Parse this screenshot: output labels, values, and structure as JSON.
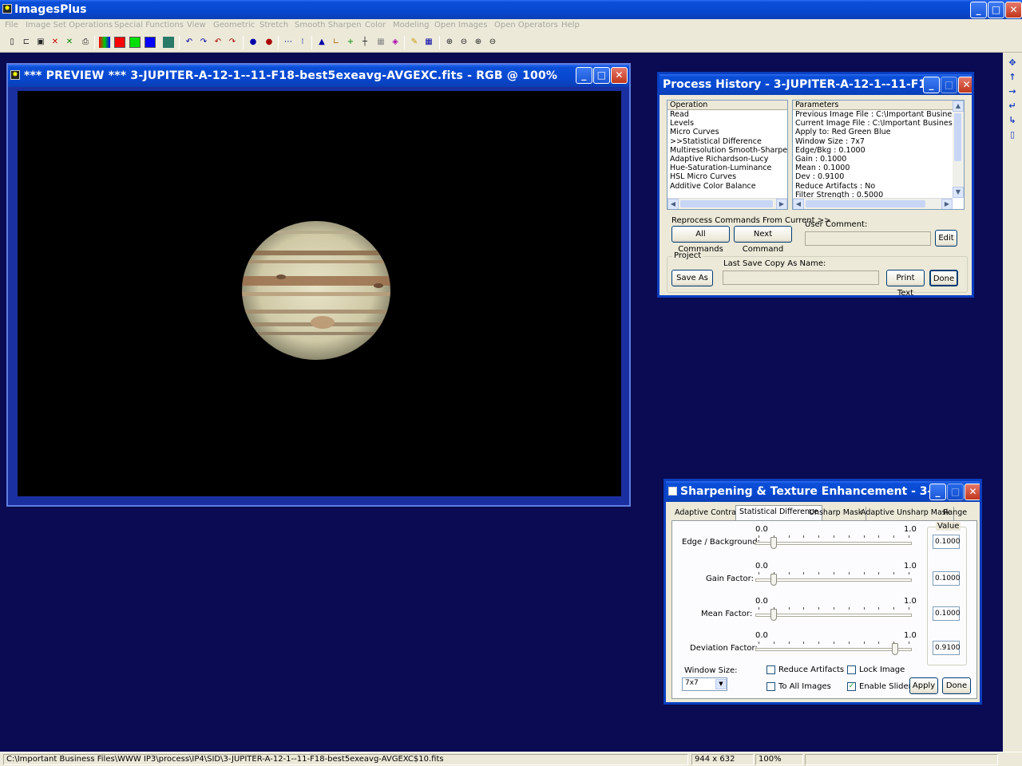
{
  "app": {
    "title": "ImagesPlus"
  },
  "menu": [
    "File",
    "Image Set Operations",
    "Special Functions",
    "View",
    "Geometric",
    "Stretch",
    "Smooth Sharpen",
    "Color",
    "Modeling",
    "Open Images",
    "Open Operators",
    "Help"
  ],
  "preview": {
    "title": "*** PREVIEW *** 3-JUPITER-A-12-1--11-F18-best5exeavg-AVGEXC.fits - RGB @  100%"
  },
  "history": {
    "title": "Process History - 3-JUPITER-A-12-1--11-F1...",
    "operation_header": "Operation",
    "operations": [
      "Read",
      "Levels",
      "Micro Curves",
      ">>Statistical Difference",
      "Multiresolution Smooth-Sharpen",
      "Adaptive Richardson-Lucy",
      "Hue-Saturation-Luminance",
      "HSL Micro Curves",
      "Additive Color Balance"
    ],
    "parameters_header": "Parameters",
    "parameters": [
      "Previous Image File : C:\\Important Business Files\\W",
      "Current Image File : C:\\Important Business Files\\W",
      "Apply to:  Red Green Blue",
      "Window Size : 7x7",
      "Edge/Bkg : 0.1000",
      "Gain : 0.1000",
      "Mean : 0.1000",
      "Dev : 0.9100",
      "Reduce Artifacts : No",
      "Filter Strength : 0.5000"
    ],
    "reprocess_label": "Reprocess Commands From Current >>",
    "all_commands": "All Commands",
    "next_command": "Next Command",
    "user_comment_label": "User Comment:",
    "user_comment_value": "",
    "edit": "Edit",
    "project_label": "Project",
    "last_save_label": "Last Save Copy As Name:",
    "last_save_value": "",
    "save_as": "Save As",
    "print_text": "Print Text",
    "done": "Done"
  },
  "sharpen": {
    "title": "Sharpening & Texture Enhancement - 3-...",
    "tabs": [
      "Adaptive Contrast",
      "Statistical Difference",
      "Unsharp Mask",
      "Adaptive Unsharp Mask",
      "Range"
    ],
    "active_tab": "Statistical Difference",
    "value_group": "Value",
    "min_label": "0.0",
    "max_label": "1.0",
    "sliders": [
      {
        "label": "Edge / Background:",
        "value": "0.1000",
        "level": 0.1
      },
      {
        "label": "Gain Factor:",
        "value": "0.1000",
        "level": 0.1
      },
      {
        "label": "Mean Factor:",
        "value": "0.1000",
        "level": 0.1
      },
      {
        "label": "Deviation Factor:",
        "value": "0.9100",
        "level": 0.91
      }
    ],
    "window_size_label": "Window Size:",
    "window_size_value": "7x7",
    "reduce_artifacts": {
      "label": "Reduce Artifacts",
      "checked": false
    },
    "lock_image": {
      "label": "Lock Image",
      "checked": false
    },
    "to_all_images": {
      "label": "To All Images",
      "checked": false
    },
    "enable_sliders": {
      "label": "Enable Sliders",
      "checked": true
    },
    "apply": "Apply",
    "done": "Done"
  },
  "status": {
    "path": "C:\\Important Business Files\\WWW IP3\\process\\IP4\\SID\\3-JUPITER-A-12-1--11-F18-best5exeavg-AVGEXC$10.fits",
    "dimensions": "944 x 632",
    "zoom": "100%"
  }
}
